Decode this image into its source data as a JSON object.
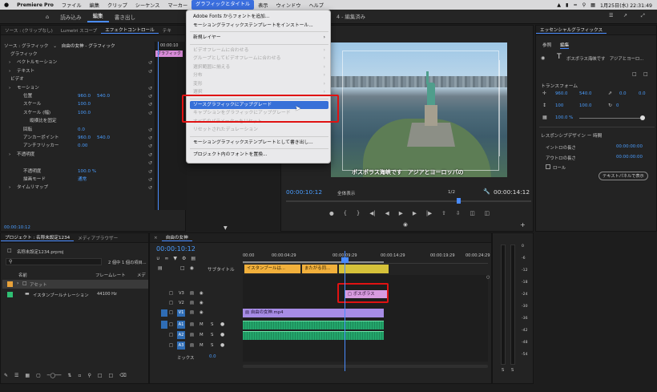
{
  "menubar": {
    "items": [
      "Premiere Pro",
      "ファイル",
      "編集",
      "クリップ",
      "シーケンス",
      "マーカー",
      "グラフィックとタイトル",
      "表示",
      "ウィンドウ",
      "ヘルプ"
    ],
    "clock": "1月25日(水)  22:31:49"
  },
  "app": {
    "workspaces": [
      "読み込み",
      "編集",
      "書き出し"
    ],
    "doc_title": "4 - 編集済み"
  },
  "effect_controls": {
    "tabs": [
      "ソース : (クリップなし)",
      "Lumetri スコープ",
      "エフェクトコントロール",
      "テキ"
    ],
    "source_row": "ソース : グラフィック",
    "clip_path": "自由の女神 - グラフィック",
    "time": "00:00:10",
    "clip_label": "グラフィック",
    "rows": [
      {
        "label": "グラフィック",
        "indent": 0
      },
      {
        "label": "ベクトルモーション",
        "indent": 1
      },
      {
        "label": "テキスト",
        "indent": 1
      },
      {
        "label": "ビデオ",
        "indent": 0
      },
      {
        "label": "モーション",
        "indent": 1
      },
      {
        "label": "位置",
        "indent": 2,
        "v1": "960.0",
        "v2": "540.0"
      },
      {
        "label": "スケール",
        "indent": 2,
        "v1": "100.0"
      },
      {
        "label": "スケール (幅)",
        "indent": 2,
        "v1": "100.0"
      },
      {
        "label": "縦横比を固定",
        "indent": 3
      },
      {
        "label": "回転",
        "indent": 2,
        "v1": "0.0"
      },
      {
        "label": "アンカーポイント",
        "indent": 2,
        "v1": "960.0",
        "v2": "540.0"
      },
      {
        "label": "アンチフリッカー",
        "indent": 2,
        "v1": "0.00"
      },
      {
        "label": "不透明度",
        "indent": 1
      },
      {
        "label": "",
        "indent": 2
      },
      {
        "label": "不透明度",
        "indent": 2,
        "v1": "100.0 %"
      },
      {
        "label": "描画モード",
        "indent": 2,
        "v1": "通常"
      },
      {
        "label": "タイムリマップ",
        "indent": 1
      }
    ],
    "footer_time": "00:00:10:12"
  },
  "graphics_menu": {
    "items": [
      {
        "label": "Adobe Fonts からフォントを追加...",
        "state": "normal",
        "arrow": false
      },
      {
        "label": "モーショングラフィックステンプレートをインストール...",
        "state": "normal",
        "arrow": false
      },
      {
        "sep": true
      },
      {
        "label": "新規レイヤー",
        "state": "normal",
        "arrow": true
      },
      {
        "sep": true
      },
      {
        "label": "ビデオフレームに合わせる",
        "state": "disabled",
        "arrow": true
      },
      {
        "label": "グループとしてビデオフレームに合わせる",
        "state": "disabled",
        "arrow": true
      },
      {
        "label": "選択範囲に揃える",
        "state": "disabled",
        "arrow": true
      },
      {
        "label": "分布",
        "state": "disabled",
        "arrow": true
      },
      {
        "label": "変形",
        "state": "disabled",
        "arrow": true
      },
      {
        "label": "選択",
        "state": "disabled",
        "arrow": true
      },
      {
        "sep": true
      },
      {
        "label": "ソースグラフィックにアップグレード",
        "state": "highlight",
        "arrow": false
      },
      {
        "label": "キャプションをグラフィックにアップグレード",
        "state": "disabled",
        "arrow": false
      },
      {
        "label": "すべてのパラメーターをリセット",
        "state": "disabled",
        "arrow": false
      },
      {
        "label": "リセットされたデュレーション",
        "state": "disabled",
        "arrow": false
      },
      {
        "sep": true
      },
      {
        "label": "モーショングラフィックステンプレートとして書き出し...",
        "state": "normal",
        "arrow": false
      },
      {
        "sep": true
      },
      {
        "label": "プロジェクト内のフォントを置換...",
        "state": "normal",
        "arrow": false
      }
    ]
  },
  "program": {
    "caption": "ボスポラス海峡です　アジアとヨーロッパの",
    "timecode": "00:00:10:12",
    "fit": "全体表示",
    "quality": "1/2",
    "duration": "00:00:14:12"
  },
  "essential_graphics": {
    "title": "エッセンシャルグラフィックス",
    "tabs": [
      "参照",
      "編集"
    ],
    "layer": "ボスポラス海峡です　アジアとヨーロ...",
    "transform_title": "トランスフォーム",
    "pos_x": "960.0",
    "pos_y": "540.0",
    "anchor_x": "0.0",
    "anchor_y": "0.0",
    "scale": "100",
    "scale2": "100.0",
    "rotation": "0",
    "opacity": "100.0 %",
    "responsive_title": "レスポンシブデザイン ー 時間",
    "intro_label": "イントロの長さ",
    "intro_value": "00:00:00:00",
    "outro_label": "アウトロの長さ",
    "outro_value": "00:00:00:00",
    "roll_label": "ロール",
    "text_panel_btn": "テキストパネルで表示"
  },
  "project": {
    "tabs": [
      "プロジェクト : 名称未設定1234",
      "メディアブラウザー"
    ],
    "file": "名称未設定1234.prproj",
    "count": "2 個中 1 個の項目...",
    "col_name": "名前",
    "col_fps": "フレームレート",
    "col_media": "メディ",
    "items": [
      {
        "name": "アセット",
        "fps": "",
        "color": "#e8a23a"
      },
      {
        "name": "イスタンブールナレーション",
        "fps": "44100 Hz",
        "color": "#2fbf73"
      }
    ]
  },
  "timeline": {
    "tab": "自由の女神",
    "timecode": "00:00:10:12",
    "ruler": [
      "00:00",
      "00:00:04:29",
      "00:00:09:29",
      "00:00:14:29",
      "00:00:19:29",
      "00:00:24:29"
    ],
    "caption_track": "サブタイトル",
    "caption_clips": [
      "イスタンブールは...",
      "またがる同..."
    ],
    "video_tracks": [
      "V3",
      "V2",
      "V1"
    ],
    "audio_tracks": [
      "A1",
      "A2",
      "A3"
    ],
    "graphic_clip": "ボスポラス",
    "video_clip": "自由の女神.mp4",
    "mix_label": "ミックス",
    "mix_value": "0.0"
  },
  "meter": {
    "labels": [
      "0",
      "-6",
      "-12",
      "-18",
      "-24",
      "-30",
      "-36",
      "-42",
      "-48",
      "-54"
    ],
    "bottom": [
      "S",
      "S"
    ]
  },
  "colors": {
    "accent": "#4a8cff",
    "highlight": "#3770d8",
    "callout": "#e01212",
    "graphic_clip": "#d89be0",
    "video_clip": "#a78ce6",
    "audio_clip": "#23a56b",
    "caption_clip": "#f1b03c"
  }
}
